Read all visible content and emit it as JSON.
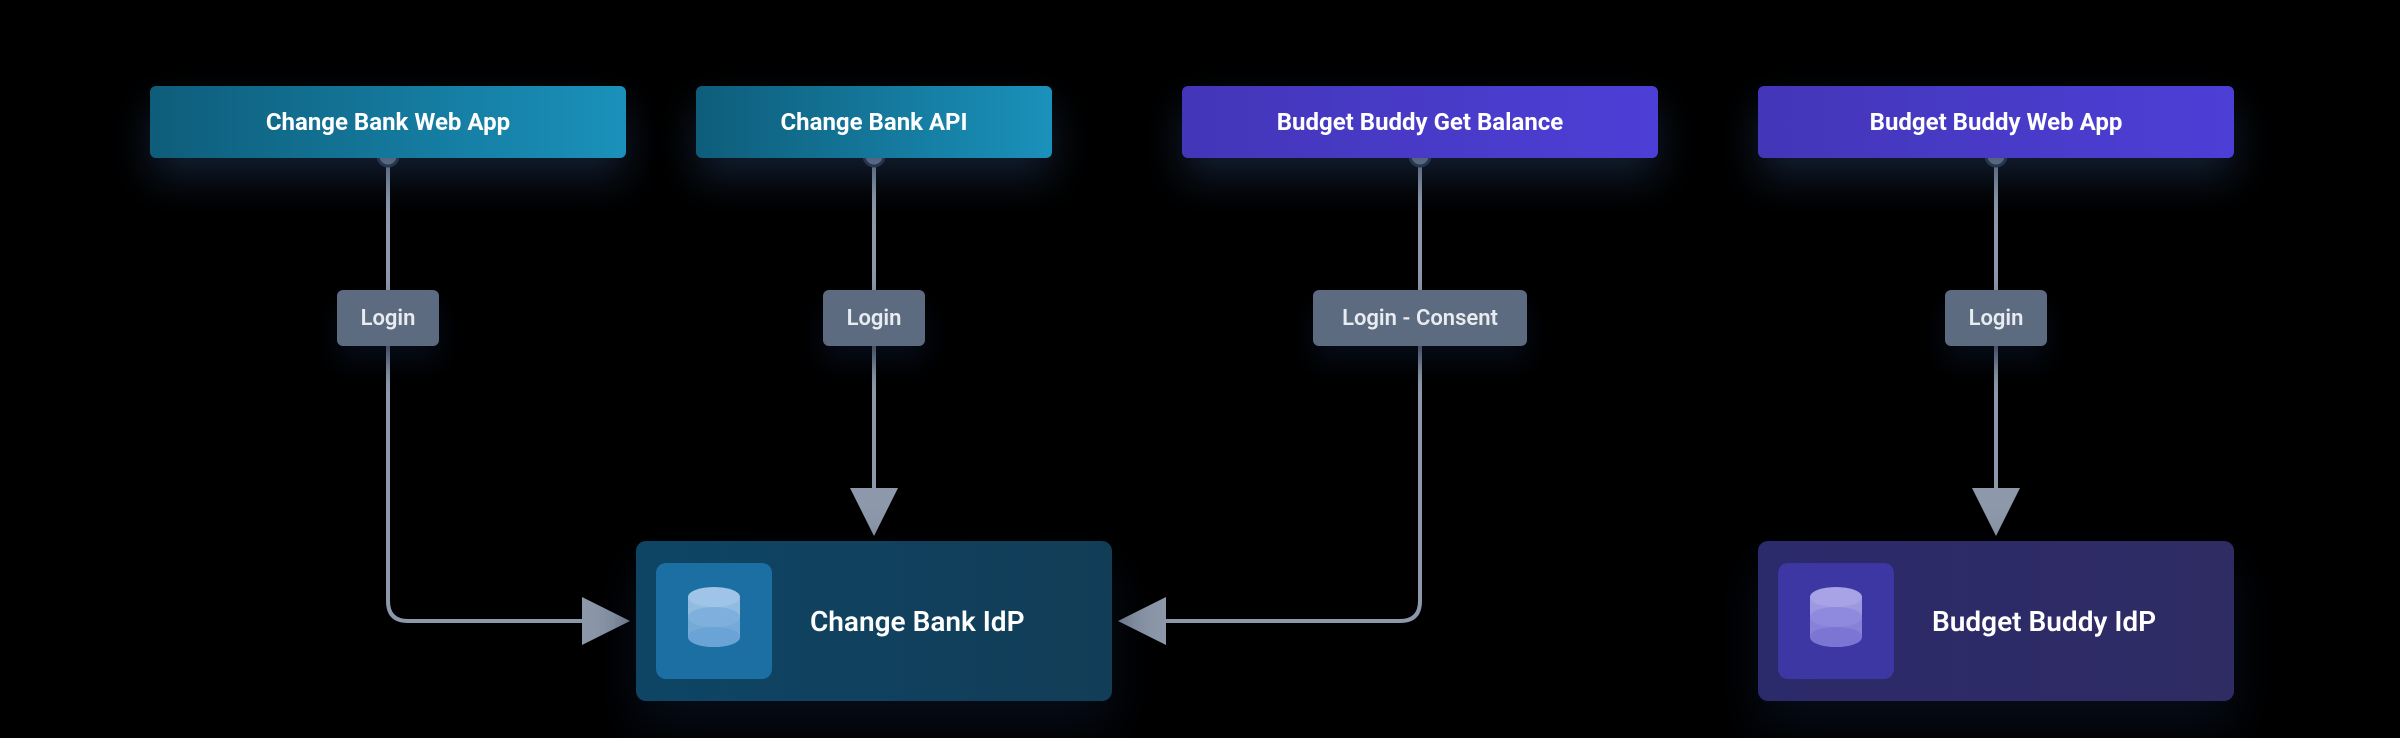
{
  "boxes": {
    "cb_web": "Change Bank Web App",
    "cb_api": "Change Bank API",
    "bb_bal": "Budget Buddy Get Balance",
    "bb_web": "Budget Buddy Web App"
  },
  "edges": {
    "login": "Login",
    "login_consent": "Login - Consent"
  },
  "idp": {
    "change_bank": "Change Bank IdP",
    "budget_buddy": "Budget Buddy IdP"
  },
  "colors": {
    "teal_grad_a": "#0e5d7a",
    "teal_grad_b": "#1a91bb",
    "purple_grad_a": "#4336b8",
    "purple_grad_b": "#4d3fd6",
    "pill": "#5d6b80",
    "line": "#8d99ab"
  }
}
